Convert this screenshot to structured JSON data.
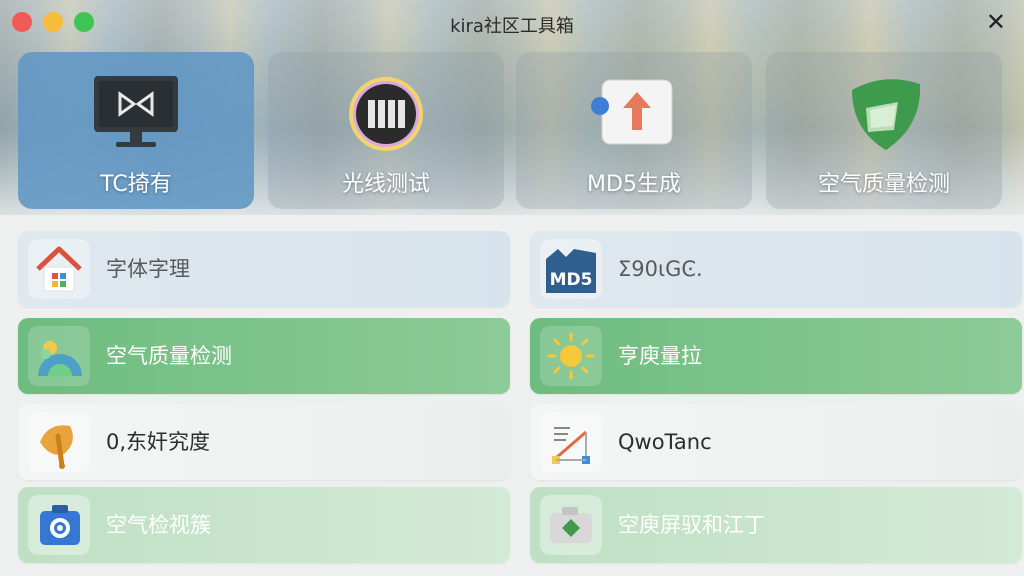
{
  "window": {
    "title": "kira社区工具箱",
    "close_glyph": "✕"
  },
  "tiles": [
    {
      "label": "TC掎有",
      "icon": "monitor-icon",
      "active": true
    },
    {
      "label": "光线测试",
      "icon": "light-test-icon",
      "active": false
    },
    {
      "label": "MD5生成",
      "icon": "upload-arrow-icon",
      "active": false
    },
    {
      "label": "空气质量检测",
      "icon": "green-shield-icon",
      "active": false
    }
  ],
  "list": [
    {
      "label": "字体字理",
      "icon": "house-icon",
      "style": "blue"
    },
    {
      "label": "Σ90ιGϾ.",
      "icon": "md5-icon",
      "style": "blue"
    },
    {
      "label": "空气质量检测",
      "icon": "air-globe-icon",
      "style": "green"
    },
    {
      "label": "亨庾量拉",
      "icon": "sun-icon",
      "style": "green"
    },
    {
      "label": "0,东奸究度",
      "icon": "leaf-icon",
      "style": "white"
    },
    {
      "label": "QwoTanc",
      "icon": "diagram-brush-icon",
      "style": "white"
    },
    {
      "label": "空气检视簇",
      "icon": "gear-toolbox-icon",
      "style": "lightgreen"
    },
    {
      "label": "空庾屏驭和江丁",
      "icon": "camera-icon",
      "style": "lightgreen"
    }
  ],
  "colors": {
    "active_tile": "#6096c4",
    "green_item": "#6ebc7f",
    "blue_item": "#dfe8ef"
  }
}
